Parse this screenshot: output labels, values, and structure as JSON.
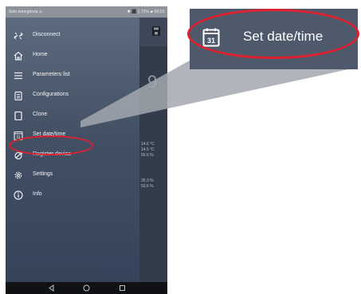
{
  "statusbar": {
    "left": "Solo emergenza ⚠",
    "right": "✱ ⬛ ▯ 72% ▰ 09:23"
  },
  "drawer": {
    "items": [
      {
        "label": "Disconnect",
        "icon": "unlink-icon"
      },
      {
        "label": "Home",
        "icon": "home-icon"
      },
      {
        "label": "Parameters list",
        "icon": "list-icon"
      },
      {
        "label": "Configurations",
        "icon": "clipboard-icon"
      },
      {
        "label": "Clone",
        "icon": "copy-icon"
      },
      {
        "label": "Set date/time",
        "icon": "calendar-icon"
      },
      {
        "label": "Register device",
        "icon": "register-icon"
      },
      {
        "label": "Settings",
        "icon": "gear-icon"
      },
      {
        "label": "Info",
        "icon": "info-icon"
      }
    ]
  },
  "background": {
    "big_value": "9",
    "readings_a": [
      "14.6 °C",
      "14.5 °C",
      "50.6 %"
    ],
    "readings_b": [
      "35.3 %",
      "50.6 %"
    ]
  },
  "zoom": {
    "label": "Set date/time",
    "calendar_day": "31"
  },
  "colors": {
    "highlight": "#e0202e",
    "drawer": "#435064"
  }
}
